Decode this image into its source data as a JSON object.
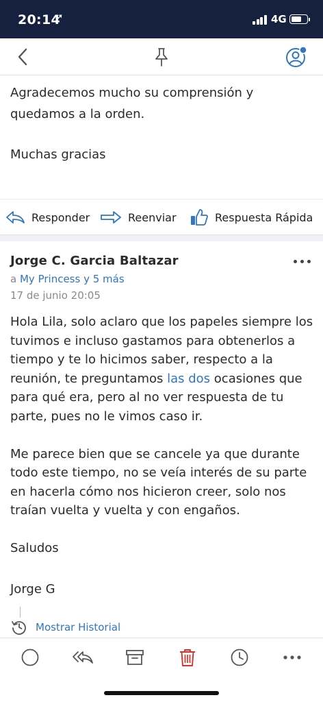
{
  "status_bar": {
    "time": "20:14",
    "location_glyph": "➚",
    "network": "4G",
    "signal_icon": "signal-bars-icon",
    "battery_icon": "battery-icon"
  },
  "nav": {
    "back_icon": "chevron-left-icon",
    "pin_icon": "pin-icon",
    "account_icon": "account-status-icon",
    "accent_color": "#2f76c5"
  },
  "previous_message": {
    "lines": [
      "Agradecemos mucho su comprensión y",
      "quedamos a la orden."
    ],
    "closing": "Muchas gracias"
  },
  "actions": {
    "reply_label": "Responder",
    "forward_label": "Reenviar",
    "quick_reply_label": "Respuesta Rápida"
  },
  "message": {
    "sender": "Jorge C. Garcia Baltazar",
    "recipients_prefix": "a",
    "recipients_link": "My Princess y 5 más",
    "date": "17 de junio 20:05",
    "p1_before": "Hola Lila, solo aclaro que los papeles siempre los tuvimos e incluso gastamos para obtenerlos a tiempo y te lo hicimos saber, respecto a la reunión, te preguntamos ",
    "p1_link": "las dos",
    "p1_after": " ocasiones que para qué era, pero al no ver respuesta de tu parte, pues no le vimos caso ir.",
    "p2": "Me parece bien que se cancele ya que durante todo este tiempo, no se veía interés de su parte en hacerla cómo nos hicieron creer, solo nos traían vuelta y vuelta y con engaños.",
    "greeting": "Saludos",
    "signature": "Jorge G",
    "history_label": "Mostrar Historial"
  },
  "toolbar": {
    "icons": [
      "circle-icon",
      "reply-all-icon",
      "archive-icon",
      "trash-icon",
      "clock-icon",
      "more-icon"
    ],
    "trash_color": "#d9322b"
  }
}
